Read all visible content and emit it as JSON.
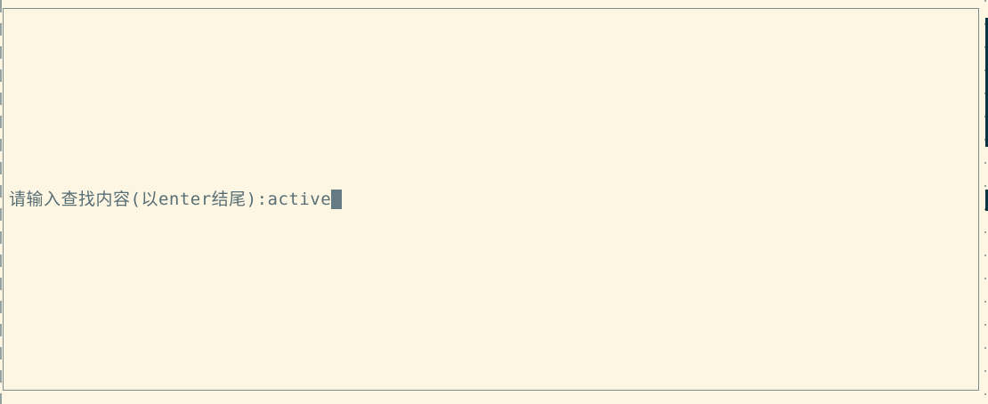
{
  "search_dialog": {
    "prompt": "请输入查找内容(以enter结尾):",
    "input_value": "active"
  },
  "colors": {
    "background": "#fdf6e3",
    "text": "#586e75",
    "border": "#7f8c8d",
    "cursor": "#657b83",
    "side_panel": "#073642"
  }
}
